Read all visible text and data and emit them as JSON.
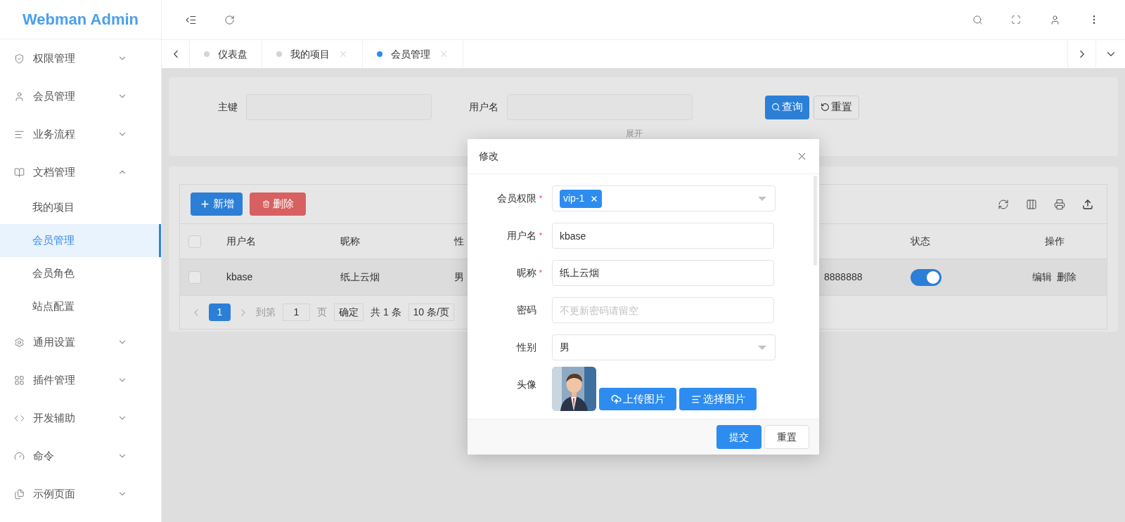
{
  "app": {
    "title": "Webman Admin"
  },
  "sidebar": {
    "items": [
      {
        "label": "权限管理",
        "expanded": false
      },
      {
        "label": "会员管理",
        "expanded": false
      },
      {
        "label": "业务流程",
        "expanded": false
      },
      {
        "label": "文档管理",
        "expanded": true,
        "children": [
          {
            "label": "我的项目",
            "selected": false
          },
          {
            "label": "会员管理",
            "selected": true
          },
          {
            "label": "会员角色",
            "selected": false
          },
          {
            "label": "站点配置",
            "selected": false
          }
        ]
      },
      {
        "label": "通用设置",
        "expanded": false
      },
      {
        "label": "插件管理",
        "expanded": false
      },
      {
        "label": "开发辅助",
        "expanded": false
      },
      {
        "label": "命令",
        "expanded": false
      },
      {
        "label": "示例页面",
        "expanded": false
      }
    ]
  },
  "tabs": [
    {
      "label": "仪表盘",
      "selected": false,
      "closable": false
    },
    {
      "label": "我的项目",
      "selected": false,
      "closable": true
    },
    {
      "label": "会员管理",
      "selected": true,
      "closable": true
    }
  ],
  "search_form": {
    "fields": [
      {
        "label": "主键"
      },
      {
        "label": "用户名"
      }
    ],
    "buttons": [
      {
        "label": "查询",
        "kind": "search"
      },
      {
        "label": "重置",
        "kind": "reset"
      }
    ],
    "expand_link": "展开"
  },
  "table": {
    "buttons": [
      {
        "label": "新增",
        "kind": "add"
      },
      {
        "label": "删除",
        "kind": "delete"
      }
    ],
    "header_checked": false,
    "columns": [
      "用户名",
      "昵称",
      "性",
      "状态",
      "操作"
    ],
    "rows": [
      {
        "checked": false,
        "cells": [
          "kbase",
          "纸上云烟",
          "男",
          "8888888"
        ],
        "status_on": true,
        "actions": [
          "编辑",
          "删除"
        ]
      }
    ],
    "pagination": {
      "pages": [
        {
          "label": "1",
          "selected": true
        }
      ],
      "goto_label": "到第",
      "goto_value": "1",
      "page_label": "页",
      "confirm": "确定",
      "total": "共 1 条",
      "page_size": "10 条/页"
    }
  },
  "modal": {
    "title": "修改",
    "required_mark": "*",
    "fields": [
      {
        "kind": "tags",
        "label": "会员权限",
        "required": true,
        "tags": [
          "vip-1"
        ]
      },
      {
        "kind": "text",
        "label": "用户名",
        "required": true,
        "value": "kbase"
      },
      {
        "kind": "text",
        "label": "昵称",
        "required": true,
        "value": "纸上云烟"
      },
      {
        "kind": "text",
        "label": "密码",
        "required": false,
        "placeholder": "不更新密码请留空"
      },
      {
        "kind": "select",
        "label": "性别",
        "required": false,
        "value": "男"
      },
      {
        "label": "头像",
        "required": false,
        "buttons": [
          "上传图片",
          "选择图片"
        ]
      }
    ],
    "buttons": [
      {
        "label": "提交",
        "kind": "primary"
      },
      {
        "label": "重置",
        "kind": "default"
      }
    ]
  }
}
